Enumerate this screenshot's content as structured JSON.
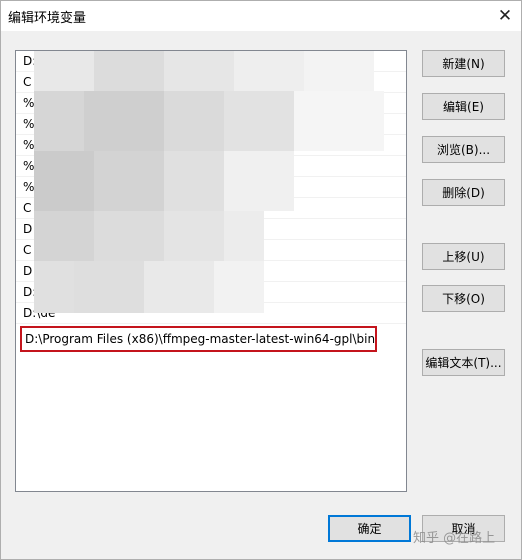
{
  "window": {
    "title": "编辑环境变量",
    "close_glyph": "✕"
  },
  "list": {
    "rows": [
      {
        "prefix": "D:\\"
      },
      {
        "prefix": "C"
      },
      {
        "prefix": "%"
      },
      {
        "prefix": "%"
      },
      {
        "prefix": "%"
      },
      {
        "prefix": "%"
      },
      {
        "prefix": "%"
      },
      {
        "prefix": "C"
      },
      {
        "prefix": "D"
      },
      {
        "prefix": "C"
      },
      {
        "prefix": "D"
      },
      {
        "prefix": "D:\\"
      },
      {
        "prefix": "D:\\de"
      }
    ],
    "selected_row": "D:\\Program Files (x86)\\ffmpeg-master-latest-win64-gpl\\bin"
  },
  "buttons": {
    "new": "新建(N)",
    "edit": "编辑(E)",
    "browse": "浏览(B)...",
    "delete": "删除(D)",
    "move_up": "上移(U)",
    "move_down": "下移(O)",
    "edit_text": "编辑文本(T)...",
    "ok": "确定",
    "cancel": "取消"
  },
  "watermark": "知乎 @在路上",
  "colors": {
    "selection_border": "#c4141c",
    "default_button_border": "#0078d7"
  }
}
